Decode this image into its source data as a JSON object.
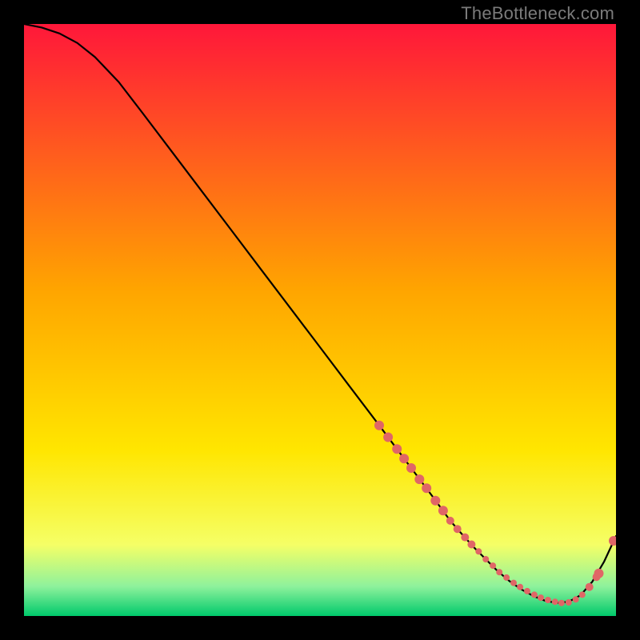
{
  "watermark": "TheBottleneck.com",
  "colors": {
    "curve": "#000000",
    "markers": "#e06666",
    "grad_top": "#ff173a",
    "grad_mid1": "#ff7a14",
    "grad_mid2": "#ffe600",
    "grad_green": "#1de47a",
    "grad_bottom": "#00c96b"
  },
  "chart_data": {
    "type": "line",
    "title": "",
    "xlabel": "",
    "ylabel": "",
    "xlim": [
      0,
      100
    ],
    "ylim": [
      0,
      100
    ],
    "curve": {
      "x": [
        0,
        3,
        6,
        9,
        12,
        16,
        20,
        25,
        30,
        35,
        40,
        45,
        50,
        55,
        60,
        63,
        66,
        69,
        72,
        74,
        76,
        78,
        80,
        82,
        84,
        86,
        88,
        90,
        92,
        94,
        96,
        98,
        100
      ],
      "y": [
        100,
        99.4,
        98.4,
        96.8,
        94.4,
        90.2,
        85,
        78.4,
        71.8,
        65.2,
        58.6,
        52,
        45.4,
        38.8,
        32.2,
        28.2,
        24.2,
        20.2,
        16.1,
        13.8,
        11.6,
        9.6,
        7.6,
        5.9,
        4.5,
        3.4,
        2.6,
        2.2,
        2.4,
        3.5,
        5.8,
        9.2,
        13.5
      ]
    },
    "markers": {
      "x": [
        60,
        61.5,
        63,
        64.2,
        65.4,
        66.8,
        68,
        69.5,
        70.8,
        72,
        73.2,
        74.5,
        75.6,
        76.8,
        78,
        79.2,
        80.3,
        81.5,
        82.7,
        83.8,
        85,
        86.2,
        87.3,
        88.5,
        89.7,
        90.8,
        92,
        93.2,
        94.3,
        95.5,
        96.7,
        97.1,
        99.6
      ],
      "y": [
        32.2,
        30.2,
        28.2,
        26.6,
        25,
        23.1,
        21.6,
        19.5,
        17.8,
        16.1,
        14.7,
        13.3,
        12.1,
        10.9,
        9.6,
        8.5,
        7.4,
        6.5,
        5.6,
        4.9,
        4.2,
        3.6,
        3.1,
        2.7,
        2.4,
        2.2,
        2.3,
        2.8,
        3.6,
        4.9,
        6.6,
        7.2,
        12.7
      ],
      "r": [
        6,
        6,
        6,
        6,
        6,
        6,
        6,
        6,
        6,
        5,
        5,
        5,
        5,
        4,
        4,
        4,
        4,
        4,
        4,
        4,
        4,
        4,
        4,
        4,
        4,
        4,
        4,
        4,
        4,
        5,
        5,
        6,
        6
      ]
    }
  }
}
